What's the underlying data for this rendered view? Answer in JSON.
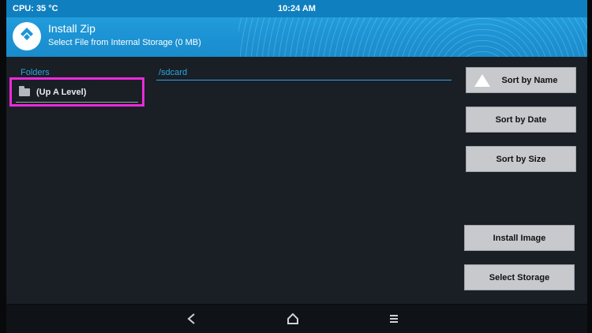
{
  "status": {
    "cpu": "CPU: 35 °C",
    "time": "10:24 AM"
  },
  "header": {
    "title": "Install Zip",
    "subtitle": "Select File from Internal Storage (0 MB)"
  },
  "folders": {
    "label": "Folders",
    "items": [
      {
        "label": "(Up A Level)"
      }
    ]
  },
  "path": {
    "value": "/sdcard"
  },
  "buttons": {
    "sort_name": "Sort by Name",
    "sort_date": "Sort by Date",
    "sort_size": "Sort by Size",
    "install_image": "Install Image",
    "select_storage": "Select Storage"
  },
  "nav": {
    "back": "back-icon",
    "home": "home-icon",
    "menu": "menu-icon"
  },
  "colors": {
    "accent": "#2AA6E0",
    "highlight": "#EA2BD8",
    "button": "#C7C9CC"
  }
}
